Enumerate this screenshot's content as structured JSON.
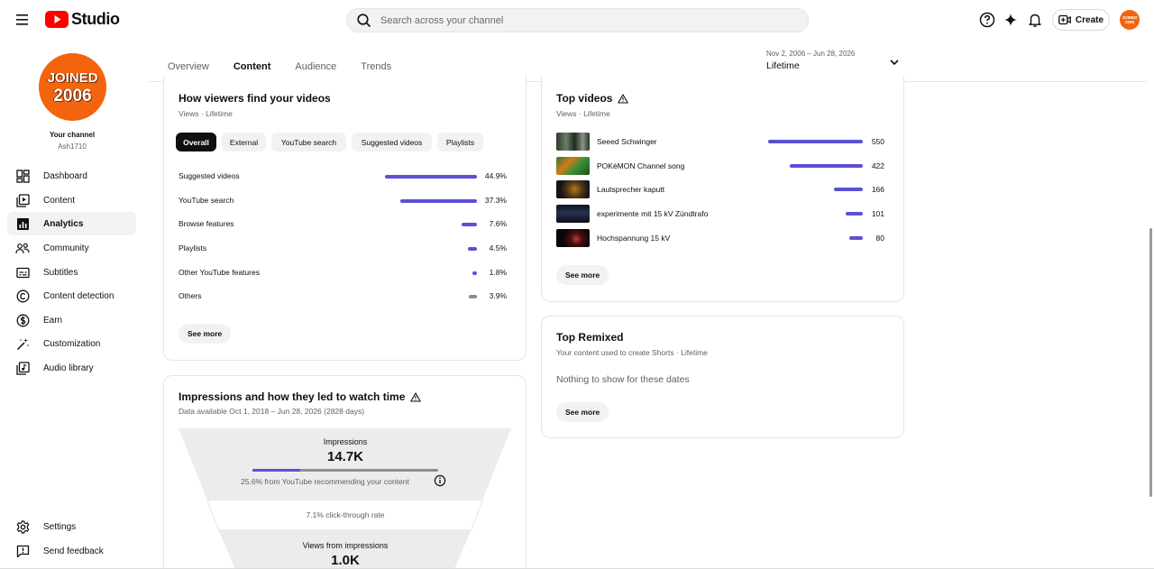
{
  "app": {
    "logo_text": "Studio"
  },
  "search": {
    "placeholder": "Search across your channel"
  },
  "header": {
    "create_label": "Create",
    "avatar_text": "JOINED 2006"
  },
  "channel": {
    "avatar_line1": "JOINED",
    "avatar_line2": "2006",
    "title": "Your channel",
    "handle": "Ash1710"
  },
  "sidebar": {
    "items": [
      {
        "label": "Dashboard",
        "icon": "dashboard-icon"
      },
      {
        "label": "Content",
        "icon": "content-icon"
      },
      {
        "label": "Analytics",
        "icon": "analytics-icon",
        "active": true
      },
      {
        "label": "Community",
        "icon": "community-icon"
      },
      {
        "label": "Subtitles",
        "icon": "subtitles-icon"
      },
      {
        "label": "Content detection",
        "icon": "copyright-icon"
      },
      {
        "label": "Earn",
        "icon": "dollar-icon"
      },
      {
        "label": "Customization",
        "icon": "magic-wand-icon"
      },
      {
        "label": "Audio library",
        "icon": "audio-library-icon"
      }
    ],
    "bottom": [
      {
        "label": "Settings",
        "icon": "gear-icon"
      },
      {
        "label": "Send feedback",
        "icon": "feedback-icon"
      }
    ]
  },
  "tabs": [
    {
      "label": "Overview"
    },
    {
      "label": "Content",
      "active": true
    },
    {
      "label": "Audience"
    },
    {
      "label": "Trends"
    }
  ],
  "date_range": {
    "range": "Nov 2, 2006 – Jun 28, 2026",
    "label": "Lifetime"
  },
  "traffic": {
    "title": "How viewers find your videos",
    "subtitle": "Views · Lifetime",
    "chips": [
      "Overall",
      "External",
      "YouTube search",
      "Suggested videos",
      "Playlists"
    ],
    "active_chip": "Overall",
    "sources": [
      {
        "label": "Suggested videos",
        "pct_text": "44.9%",
        "value": 44.9
      },
      {
        "label": "YouTube search",
        "pct_text": "37.3%",
        "value": 37.3
      },
      {
        "label": "Browse features",
        "pct_text": "7.6%",
        "value": 7.6
      },
      {
        "label": "Playlists",
        "pct_text": "4.5%",
        "value": 4.5
      },
      {
        "label": "Other YouTube features",
        "pct_text": "1.8%",
        "value": 1.8
      },
      {
        "label": "Others",
        "pct_text": "3.9%",
        "value": 3.9,
        "grey": true
      }
    ],
    "see_more": "See more"
  },
  "top_videos": {
    "title": "Top videos",
    "subtitle": "Views · Lifetime",
    "items": [
      {
        "title": "Seeed Schwinger",
        "views": 550,
        "views_text": "550"
      },
      {
        "title": "POKèMON Channel song",
        "views": 422,
        "views_text": "422"
      },
      {
        "title": "Lautsprecher kaputt",
        "views": 166,
        "views_text": "166"
      },
      {
        "title": "experimente mit 15 kV Zündtrafo",
        "views": 101,
        "views_text": "101"
      },
      {
        "title": "Hochspannung 15 kV",
        "views": 80,
        "views_text": "80"
      }
    ],
    "see_more": "See more"
  },
  "top_remixed": {
    "title": "Top Remixed",
    "subtitle": "Your content used to create Shorts · Lifetime",
    "empty": "Nothing to show for these dates",
    "see_more": "See more"
  },
  "impressions": {
    "title": "Impressions and how they led to watch time",
    "subtitle": "Data available Oct 1, 2018 – Jun 28, 2026 (2828 days)",
    "impressions_label": "Impressions",
    "impressions_value": "14.7K",
    "recommend_text": "25.6% from YouTube recommending your content",
    "recommend_fraction": 0.256,
    "ctr_text": "7.1% click-through rate",
    "views_label": "Views from impressions",
    "views_value": "1.0K"
  }
}
